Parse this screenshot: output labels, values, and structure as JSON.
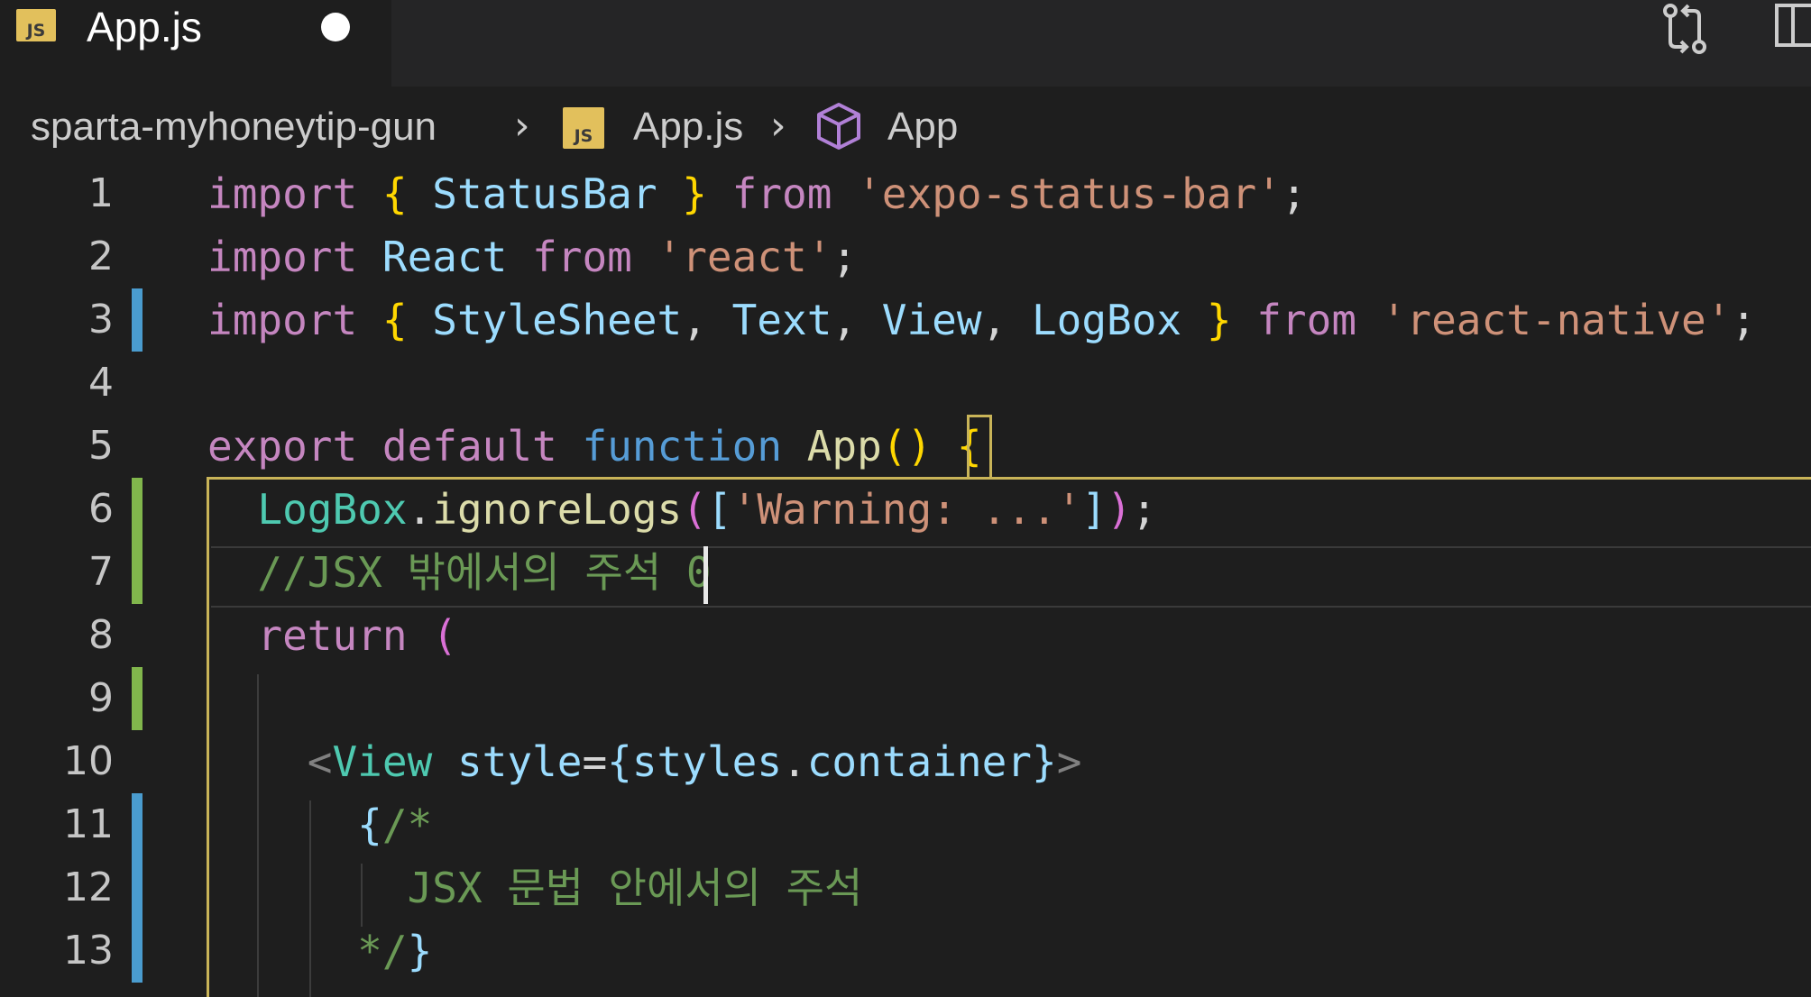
{
  "tab": {
    "file_badge": "JS",
    "title": "App.js"
  },
  "breadcrumb": {
    "folder": "sparta-myhoneytip-gun",
    "file_badge": "JS",
    "file": "App.js",
    "symbol": "App"
  },
  "icons": {
    "compare": "git-compare-icon",
    "split": "split-editor-icon",
    "symbol": "cube-icon",
    "dirty": "unsaved-dot-icon"
  },
  "colors": {
    "keyword": "#c586c0",
    "storage": "#569cd6",
    "variable": "#9cdcfe",
    "type": "#4ec9b0",
    "function": "#dcdcaa",
    "string": "#ce9178",
    "comment": "#6a9955",
    "bracket": "#ffd700",
    "gutter_added": "#81b64c",
    "gutter_modified": "#4a9ccf",
    "scope_outline": "#c9b458"
  },
  "editor": {
    "cursor_line": 7,
    "lines": [
      {
        "number": "1",
        "change": "none",
        "tokens": [
          {
            "t": "import",
            "c": "kw"
          },
          {
            "t": " ",
            "c": "pn"
          },
          {
            "t": "{",
            "c": "br"
          },
          {
            "t": " StatusBar ",
            "c": "id"
          },
          {
            "t": "}",
            "c": "br"
          },
          {
            "t": " ",
            "c": "pn"
          },
          {
            "t": "from",
            "c": "kw"
          },
          {
            "t": " ",
            "c": "pn"
          },
          {
            "t": "'expo-status-bar'",
            "c": "str"
          },
          {
            "t": ";",
            "c": "pn"
          }
        ]
      },
      {
        "number": "2",
        "change": "none",
        "tokens": [
          {
            "t": "import",
            "c": "kw"
          },
          {
            "t": " ",
            "c": "pn"
          },
          {
            "t": "React",
            "c": "id"
          },
          {
            "t": " ",
            "c": "pn"
          },
          {
            "t": "from",
            "c": "kw"
          },
          {
            "t": " ",
            "c": "pn"
          },
          {
            "t": "'react'",
            "c": "str"
          },
          {
            "t": ";",
            "c": "pn"
          }
        ]
      },
      {
        "number": "3",
        "change": "modified",
        "tokens": [
          {
            "t": "import",
            "c": "kw"
          },
          {
            "t": " ",
            "c": "pn"
          },
          {
            "t": "{",
            "c": "br"
          },
          {
            "t": " StyleSheet",
            "c": "id"
          },
          {
            "t": ", ",
            "c": "pn"
          },
          {
            "t": "Text",
            "c": "id"
          },
          {
            "t": ", ",
            "c": "pn"
          },
          {
            "t": "View",
            "c": "id"
          },
          {
            "t": ", ",
            "c": "pn"
          },
          {
            "t": "LogBox ",
            "c": "id"
          },
          {
            "t": "}",
            "c": "br"
          },
          {
            "t": " ",
            "c": "pn"
          },
          {
            "t": "from",
            "c": "kw"
          },
          {
            "t": " ",
            "c": "pn"
          },
          {
            "t": "'react-native'",
            "c": "str"
          },
          {
            "t": ";",
            "c": "pn"
          }
        ]
      },
      {
        "number": "4",
        "change": "none",
        "tokens": []
      },
      {
        "number": "5",
        "change": "none",
        "tokens": [
          {
            "t": "export",
            "c": "kw"
          },
          {
            "t": " ",
            "c": "pn"
          },
          {
            "t": "default",
            "c": "kw"
          },
          {
            "t": " ",
            "c": "pn"
          },
          {
            "t": "function",
            "c": "kw2"
          },
          {
            "t": " ",
            "c": "pn"
          },
          {
            "t": "App",
            "c": "fn"
          },
          {
            "t": "()",
            "c": "br"
          },
          {
            "t": " ",
            "c": "pn"
          },
          {
            "t": "{",
            "c": "br"
          }
        ]
      },
      {
        "number": "6",
        "change": "added",
        "tokens": [
          {
            "t": "  ",
            "c": "pn"
          },
          {
            "t": "LogBox",
            "c": "ty"
          },
          {
            "t": ".",
            "c": "pn"
          },
          {
            "t": "ignoreLogs",
            "c": "fn"
          },
          {
            "t": "(",
            "c": "brk"
          },
          {
            "t": "[",
            "c": "id"
          },
          {
            "t": "'Warning: ...'",
            "c": "str"
          },
          {
            "t": "]",
            "c": "id"
          },
          {
            "t": ")",
            "c": "brk"
          },
          {
            "t": ";",
            "c": "pn"
          }
        ]
      },
      {
        "number": "7",
        "change": "added",
        "tokens": [
          {
            "t": "  ",
            "c": "pn"
          },
          {
            "t": "//JSX 밖에서의 주석 0",
            "c": "cm"
          }
        ]
      },
      {
        "number": "8",
        "change": "none",
        "tokens": [
          {
            "t": "  ",
            "c": "pn"
          },
          {
            "t": "return",
            "c": "kw"
          },
          {
            "t": " ",
            "c": "pn"
          },
          {
            "t": "(",
            "c": "brk"
          }
        ]
      },
      {
        "number": "9",
        "change": "added",
        "tokens": []
      },
      {
        "number": "10",
        "change": "none",
        "tokens": [
          {
            "t": "    ",
            "c": "pn"
          },
          {
            "t": "<",
            "c": "ang"
          },
          {
            "t": "View",
            "c": "tag"
          },
          {
            "t": " ",
            "c": "pn"
          },
          {
            "t": "style",
            "c": "attr"
          },
          {
            "t": "=",
            "c": "pn"
          },
          {
            "t": "{",
            "c": "id"
          },
          {
            "t": "styles",
            "c": "id"
          },
          {
            "t": ".",
            "c": "pn"
          },
          {
            "t": "container",
            "c": "id"
          },
          {
            "t": "}",
            "c": "id"
          },
          {
            "t": ">",
            "c": "ang"
          }
        ]
      },
      {
        "number": "11",
        "change": "modified",
        "tokens": [
          {
            "t": "      ",
            "c": "pn"
          },
          {
            "t": "{",
            "c": "id"
          },
          {
            "t": "/*",
            "c": "cm"
          }
        ]
      },
      {
        "number": "12",
        "change": "modified",
        "tokens": [
          {
            "t": "        ",
            "c": "pn"
          },
          {
            "t": "JSX 문법 안에서의 주석",
            "c": "cm"
          }
        ]
      },
      {
        "number": "13",
        "change": "modified",
        "tokens": [
          {
            "t": "      ",
            "c": "pn"
          },
          {
            "t": "*/",
            "c": "cm"
          },
          {
            "t": "}",
            "c": "id"
          }
        ]
      }
    ]
  }
}
